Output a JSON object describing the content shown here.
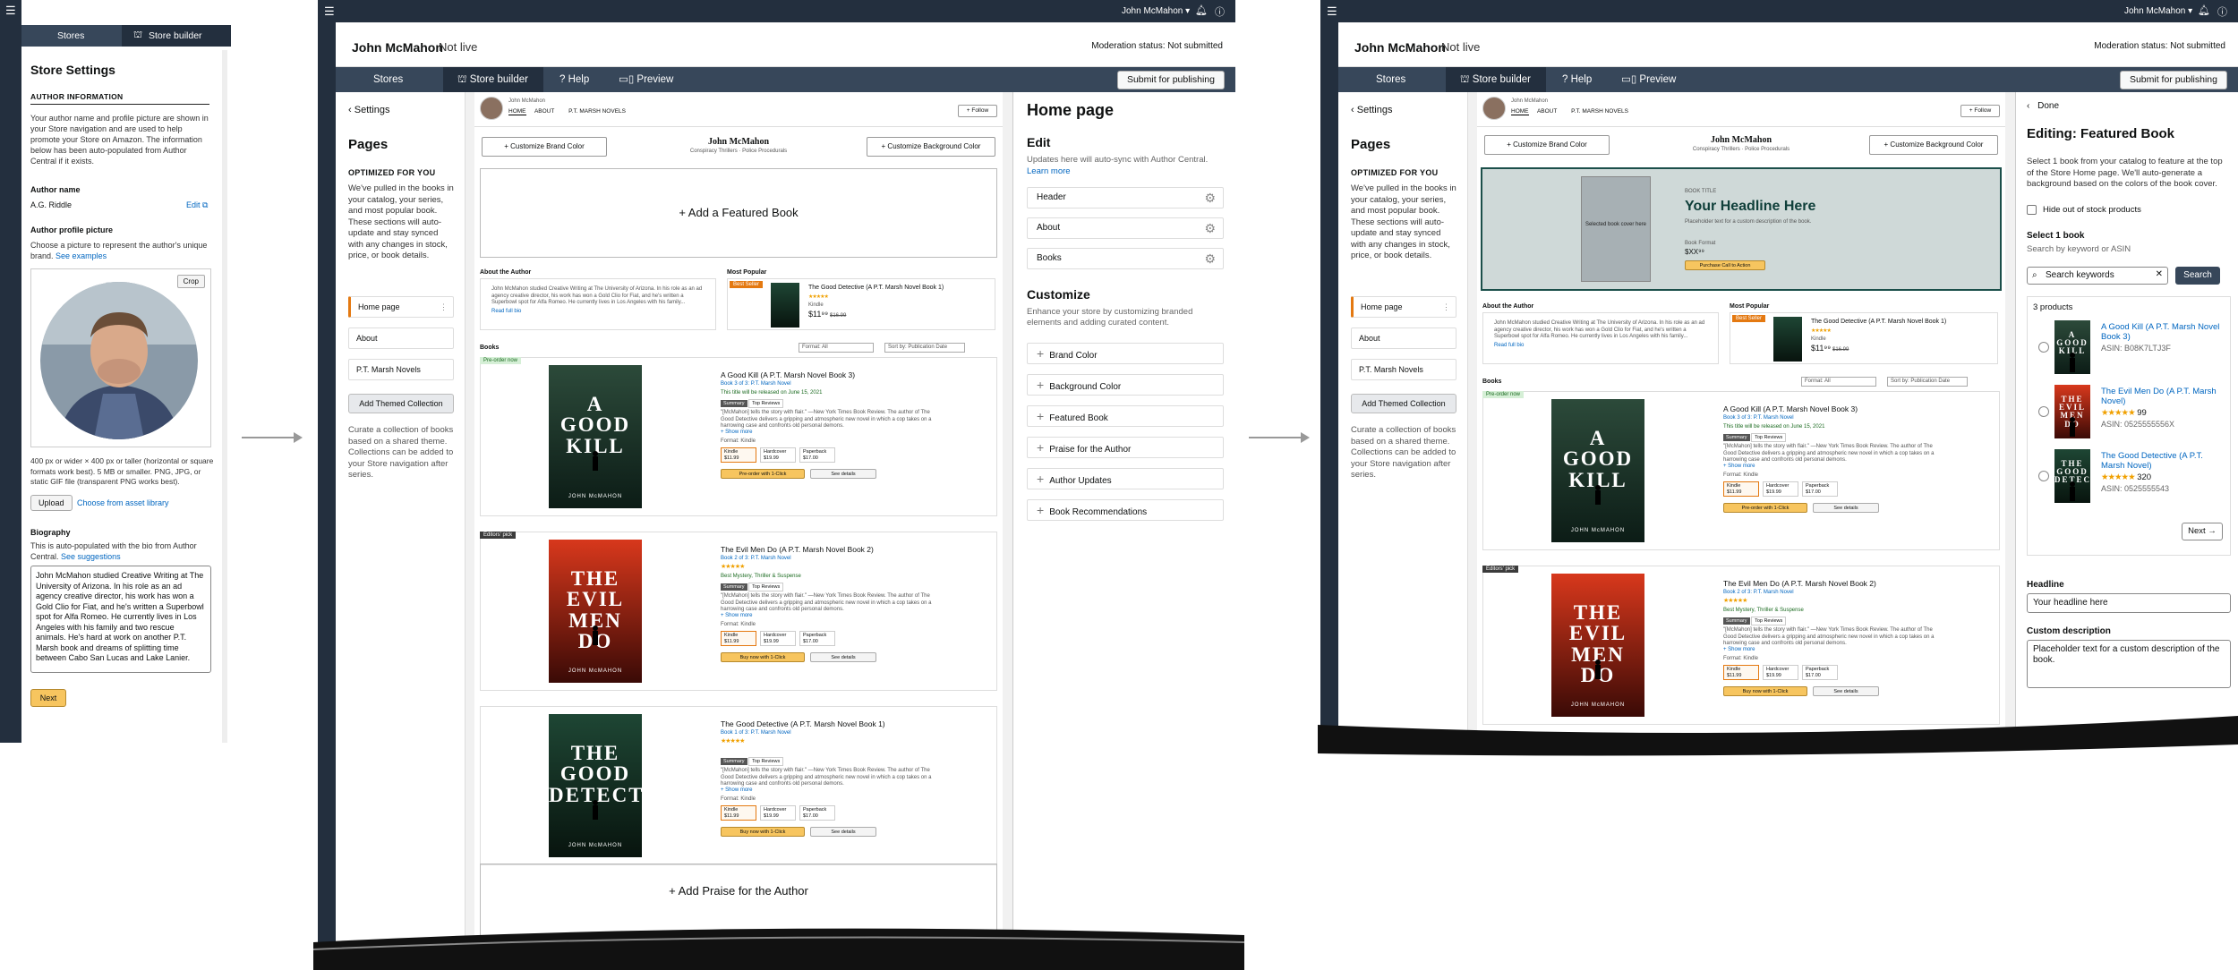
{
  "global": {
    "user": "John McMahon",
    "author_name": "John McMahon",
    "status": "Not live",
    "moderation": "Moderation status: Not submitted",
    "nav": {
      "stores": "Stores",
      "store_builder": "Store builder",
      "help": "Help",
      "preview": "Preview"
    },
    "submit": "Submit for publishing"
  },
  "settings_panel": {
    "title": "Store Settings",
    "section": "AUTHOR INFORMATION",
    "intro": "Your author name and profile picture are shown in your Store navigation and are used to help promote your Store on Amazon. The information below has been auto-populated from Author Central if it exists.",
    "author_name_label": "Author name",
    "author_name_value": "A.G. Riddle",
    "edit": "Edit",
    "pic_label": "Author profile picture",
    "pic_desc": "Choose a picture to represent the author's unique brand.",
    "see_examples": "See examples",
    "crop": "Crop",
    "pic_req": "400 px or wider × 400 px or taller (horizontal or square formats work best). 5 MB or smaller. PNG, JPG, or static GIF file (transparent PNG works best).",
    "upload": "Upload",
    "choose_asset": "Choose from asset library",
    "bio_label": "Biography",
    "bio_desc": "This is auto-populated with the bio from Author Central.",
    "see_suggestions": "See suggestions",
    "bio_text": "John McMahon studied Creative Writing at The University of Arizona. In his role as an ad agency creative director, his work has won a Gold Clio for Fiat, and he's written a Superbowl spot for Alfa Romeo. He currently lives in Los Angeles with his family and two rescue animals. He's hard at work on another P.T. Marsh book and dreams of splitting time between Cabo San Lucas and Lake Lanier.",
    "next": "Next"
  },
  "pages_panel": {
    "settings": "Settings",
    "title": "Pages",
    "optimized": "OPTIMIZED FOR YOU",
    "desc": "We've pulled in the books in your catalog, your series, and most popular book. These sections will auto-update and stay synced with any changes in stock, price, or book details.",
    "items": [
      "Home page",
      "About",
      "P.T. Marsh Novels"
    ],
    "add_theme": "Add Themed Collection",
    "curate": "Curate a collection of books based on a shared theme. Collections can be added to your Store navigation after series."
  },
  "store": {
    "header_name": "John McMahon",
    "tabs": [
      "HOME",
      "ABOUT",
      "P.T. MARSH NOVELS"
    ],
    "follow": "+ Follow",
    "brand_color": "+ Customize Brand Color",
    "bg_color": "+ Customize Background Color",
    "subtitle": "Conspiracy Thrillers · Police Procedurals",
    "add_featured": "+ Add a Featured Book",
    "about_author": "About the Author",
    "about_text": "John McMahon studied Creative Writing at The University of Arizona. In his role as an ad agency creative director, his work has won a Gold Clio for Fiat, and he's written a Superbowl spot for Alfa Romeo. He currently lives in Los Angeles with his family...",
    "read_full": "Read full bio",
    "most_popular": "Most Popular",
    "best_seller": "Best Seller",
    "popular_title": "The Good Detective (A P.T. Marsh Novel Book 1)",
    "popular_format": "Kindle",
    "popular_price": "$11⁹⁹",
    "popular_old": "$16.99",
    "books": "Books",
    "format_all": "Format: All",
    "sort": "Sort by: Publication Date",
    "add_praise": "+ Add Praise for the Author",
    "featured_book_title_label": "BOOK TITLE",
    "featured_headline": "Your Headline Here",
    "featured_placeholder": "Placeholder text for a custom description of the book.",
    "featured_format": "Book Format",
    "featured_price": "$XX⁹⁹",
    "featured_cta": "Purchase Call to Action",
    "selected_cover": "Selected book cover here",
    "book_list": [
      {
        "badge": "Pre-order now",
        "title": "A Good Kill (A P.T. Marsh Novel Book 3)",
        "series": "Book 3 of 3: P.T. Marsh Novel",
        "note": "This title will be released on June 15, 2021",
        "cover_title": "A GOOD KILL",
        "author": "JOHN McMAHON",
        "cta": "Pre-order with 1-Click",
        "details": "See details",
        "colors": [
          "#2c4a3a",
          "#0c1c16"
        ]
      },
      {
        "badge": "Editors' pick",
        "title": "The Evil Men Do (A P.T. Marsh Novel Book 2)",
        "series": "Book 2 of 3: P.T. Marsh Novel",
        "note": "Best Mystery, Thriller & Suspense",
        "cover_title": "THE EVIL MEN DO",
        "author": "JOHN McMAHON",
        "cta": "Buy now with 1-Click",
        "details": "See details",
        "colors": [
          "#d8381c",
          "#3a0a06"
        ]
      },
      {
        "badge": "",
        "title": "The Good Detective (A P.T. Marsh Novel Book 1)",
        "series": "Book 1 of 3: P.T. Marsh Novel",
        "note": "",
        "cover_title": "THE GOOD DETECTIVE",
        "author": "JOHN McMAHON",
        "cta": "Buy now with 1-Click",
        "details": "See details",
        "colors": [
          "#1e4634",
          "#08140e"
        ]
      }
    ],
    "summary": "Summary",
    "top_reviews": "Top Reviews",
    "blurb": "\"[McMahon] tells the story with flair.\" —New York Times Book Review. The author of The Good Detective delivers a gripping and atmospheric new novel in which a cop takes on a harrowing case and confronts old personal demons.",
    "show_more": "+ Show more",
    "format_kindle": "Format: Kindle",
    "formats": [
      "Kindle",
      "Hardcover",
      "Paperback"
    ],
    "prices": [
      "$11.99",
      "$19.99",
      "$17.00"
    ]
  },
  "home_edit": {
    "title": "Home page",
    "edit": "Edit",
    "edit_desc": "Updates here will auto-sync with Author Central.",
    "learn_more": "Learn more",
    "rows": [
      "Header",
      "About",
      "Books"
    ],
    "customize": "Customize",
    "customize_desc": "Enhance your store by customizing branded elements and adding curated content.",
    "items": [
      "Brand Color",
      "Background Color",
      "Featured Book",
      "Praise for the Author",
      "Author Updates",
      "Book Recommendations"
    ]
  },
  "featured_edit": {
    "done": "Done",
    "title": "Editing: Featured Book",
    "desc": "Select 1 book from your catalog to feature at the top of the Store Home page. We'll auto-generate a background based on the colors of the book cover.",
    "hide_stock": "Hide out of stock products",
    "select_label": "Select 1 book",
    "search_hint": "Search by keyword or ASIN",
    "search_placeholder": "Search keywords",
    "search_btn": "Search",
    "count": "3 products",
    "products": [
      {
        "title": "A Good Kill (A P.T. Marsh Novel Book 3)",
        "asin": "ASIN: B08K7LTJ3F",
        "rating": "",
        "colors": [
          "#2c4a3a",
          "#0c1c16"
        ],
        "cover_title": "A GOOD KILL"
      },
      {
        "title": "The Evil Men Do (A P.T. Marsh Novel)",
        "asin": "ASIN: 0525555556X",
        "rating": "99",
        "colors": [
          "#d8381c",
          "#3a0a06"
        ],
        "cover_title": "THE EVIL MEN DO"
      },
      {
        "title": "The Good Detective (A P.T. Marsh Novel)",
        "asin": "ASIN: 0525555543",
        "rating": "320",
        "colors": [
          "#1e4634",
          "#08140e"
        ],
        "cover_title": "THE GOOD DETECTIVE"
      }
    ],
    "next": "Next →",
    "headline_label": "Headline",
    "headline_value": "Your headline here",
    "custom_label": "Custom description",
    "custom_value": "Placeholder text for a custom description of the book."
  }
}
